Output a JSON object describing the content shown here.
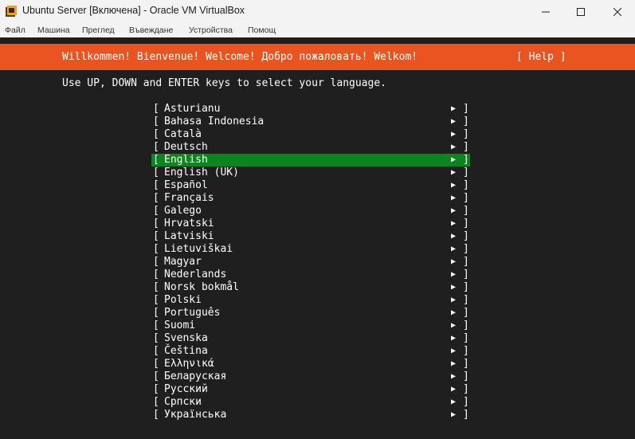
{
  "window": {
    "title": "Ubuntu  Server [Включена] - Oracle VM VirtualBox"
  },
  "menu": [
    "Файл",
    "Машина",
    "Преглед",
    "Въвеждане",
    "Устройства",
    "Помощ"
  ],
  "installer": {
    "header_title": "Willkommen! Bienvenue! Welcome! Добро пожаловать! Welkom!",
    "help_label": "[ Help ]",
    "instructions": "Use UP, DOWN and ENTER keys to select your language.",
    "bracket_open": "[",
    "bracket_close": "]",
    "arrow_glyph": "▶",
    "selected_index": 4,
    "languages": [
      "Asturianu",
      "Bahasa Indonesia",
      "Català",
      "Deutsch",
      "English",
      "English (UK)",
      "Español",
      "Français",
      "Galego",
      "Hrvatski",
      "Latviski",
      "Lietuviškai",
      "Magyar",
      "Nederlands",
      "Norsk bokmål",
      "Polski",
      "Português",
      "Suomi",
      "Svenska",
      "Čeština",
      "Ελληνικά",
      "Беларуская",
      "Русский",
      "Српски",
      "Українська"
    ]
  },
  "colors": {
    "header_orange": "#e95420",
    "selection_green": "#0e8420",
    "terminal_bg": "#1f1f1f",
    "chrome_bg": "#f3f3f3"
  },
  "icons": {
    "app": "virtualbox-icon",
    "minimize": "minimize-icon",
    "maximize": "maximize-icon",
    "close": "close-icon"
  }
}
